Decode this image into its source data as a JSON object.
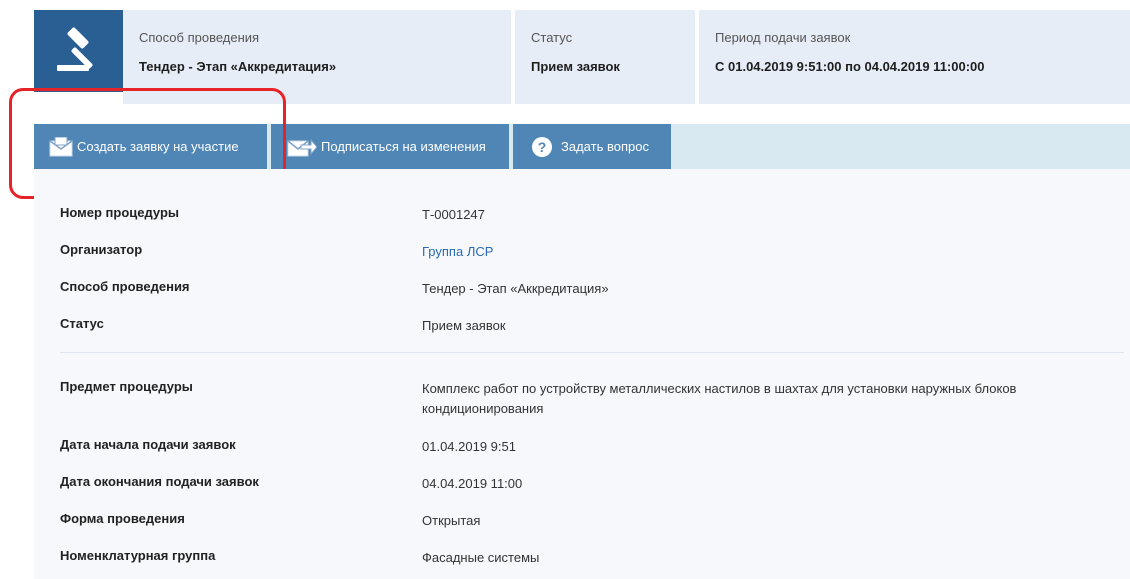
{
  "header": {
    "method_label": "Способ проведения",
    "method_value": "Тендер - Этап «Аккредитация»",
    "status_label": "Статус",
    "status_value": "Прием заявок",
    "period_label": "Период подачи заявок",
    "period_value": "С 01.04.2019 9:51:00 по 04.04.2019 11:00:00",
    "icon": "gavel-icon"
  },
  "toolbar": {
    "create_label": "Создать заявку на участие",
    "subscribe_label": "Подписаться на изменения",
    "ask_label": "Задать вопрос"
  },
  "details": {
    "number_label": "Номер процедуры",
    "number_value": "Т-0001247",
    "organizer_label": "Организатор",
    "organizer_value": "Группа ЛСР",
    "method_label": "Способ проведения",
    "method_value": "Тендер - Этап «Аккредитация»",
    "status_label": "Статус",
    "status_value": "Прием заявок",
    "subject_label": "Предмет процедуры",
    "subject_value": "Комплекс работ по устройству металлических настилов в шахтах для установки наружных блоков кондиционирования",
    "start_label": "Дата начала подачи заявок",
    "start_value": "01.04.2019 9:51",
    "end_label": "Дата окончания подачи заявок",
    "end_value": "04.04.2019 11:00",
    "form_label": "Форма проведения",
    "form_value": "Открытая",
    "group_label": "Номенклатурная группа",
    "group_value": "Фасадные системы"
  },
  "colors": {
    "accent": "#2a5f94",
    "button": "#4f86b5",
    "toolbar_bg": "#d8e9f1",
    "highlight": "#e62327",
    "link": "#2a6cb0"
  }
}
